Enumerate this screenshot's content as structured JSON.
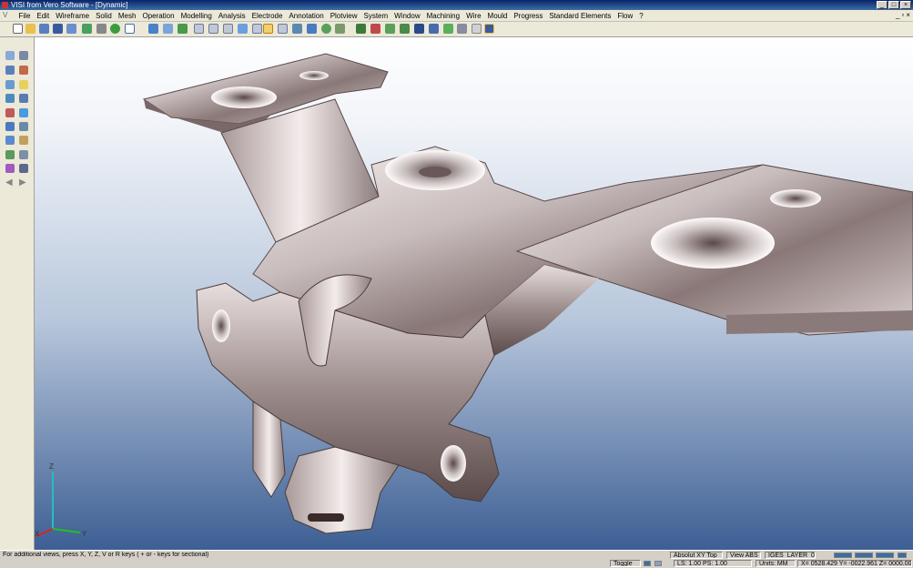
{
  "window": {
    "title": "VISI from Vero Software - [Dynamic]"
  },
  "menu": [
    "File",
    "Edit",
    "Wireframe",
    "Solid",
    "Mesh",
    "Operation",
    "Modelling",
    "Analysis",
    "Electrode",
    "Annotation",
    "Plotview",
    "System",
    "Window",
    "Machining",
    "Wire",
    "Mould",
    "Progress",
    "Standard Elements",
    "Flow",
    "?"
  ],
  "axes": {
    "z": "Z",
    "x": "X",
    "y": "Y"
  },
  "status": {
    "hint": "For additional views, press X, Y, Z, V or R keys ( + or - keys for sectional)",
    "toggle": "Toggle",
    "view_name": "Absolut XY Top",
    "view_abs": "View ABS",
    "layer": "IGES_LAYER_0",
    "ls_ps": "LS: 1.00 PS: 1.00",
    "units": "Units: MM",
    "coords": "X= 0528.429 Y= -0022.961 Z= 0000.000"
  },
  "colors": {
    "viewport_top": "#ffffff",
    "viewport_bottom": "#3d5f94",
    "titlebar": "#0a246a",
    "chrome": "#ece9d8"
  }
}
